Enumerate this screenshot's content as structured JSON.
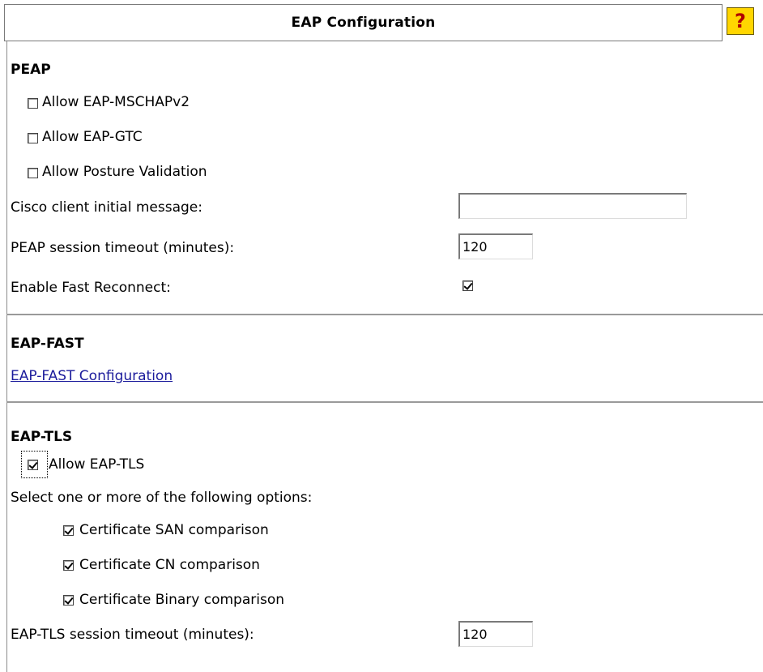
{
  "header": {
    "title": "EAP Configuration",
    "help_glyph": "?",
    "help_icon": "help-question-icon"
  },
  "peap": {
    "title": "PEAP",
    "allow_mschapv2": {
      "label": "Allow EAP-MSCHAPv2",
      "checked": false
    },
    "allow_gtc": {
      "label": "Allow EAP-GTC",
      "checked": false
    },
    "allow_posture": {
      "label": "Allow Posture Validation",
      "checked": false
    },
    "initial_message": {
      "label": "Cisco client initial message:",
      "value": ""
    },
    "session_timeout": {
      "label": "PEAP session timeout (minutes):",
      "value": "120"
    },
    "fast_reconnect": {
      "label": "Enable Fast Reconnect:",
      "checked": true
    }
  },
  "eap_fast": {
    "title": "EAP-FAST",
    "link": "EAP-FAST Configuration"
  },
  "eap_tls": {
    "title": "EAP-TLS",
    "allow_tls": {
      "label": "Allow EAP-TLS",
      "checked": true
    },
    "options_label": "Select one or more of the following options:",
    "san": {
      "label": "Certificate SAN comparison",
      "checked": true
    },
    "cn": {
      "label": "Certificate CN comparison",
      "checked": true
    },
    "binary": {
      "label": "Certificate Binary comparison",
      "checked": true
    },
    "session_timeout": {
      "label": "EAP-TLS session timeout (minutes):",
      "value": "120"
    }
  },
  "colors": {
    "help_bg": "#ffd600",
    "help_glyph": "#b00000",
    "link": "#1c1c9c",
    "divider": "#9a9a9a"
  }
}
